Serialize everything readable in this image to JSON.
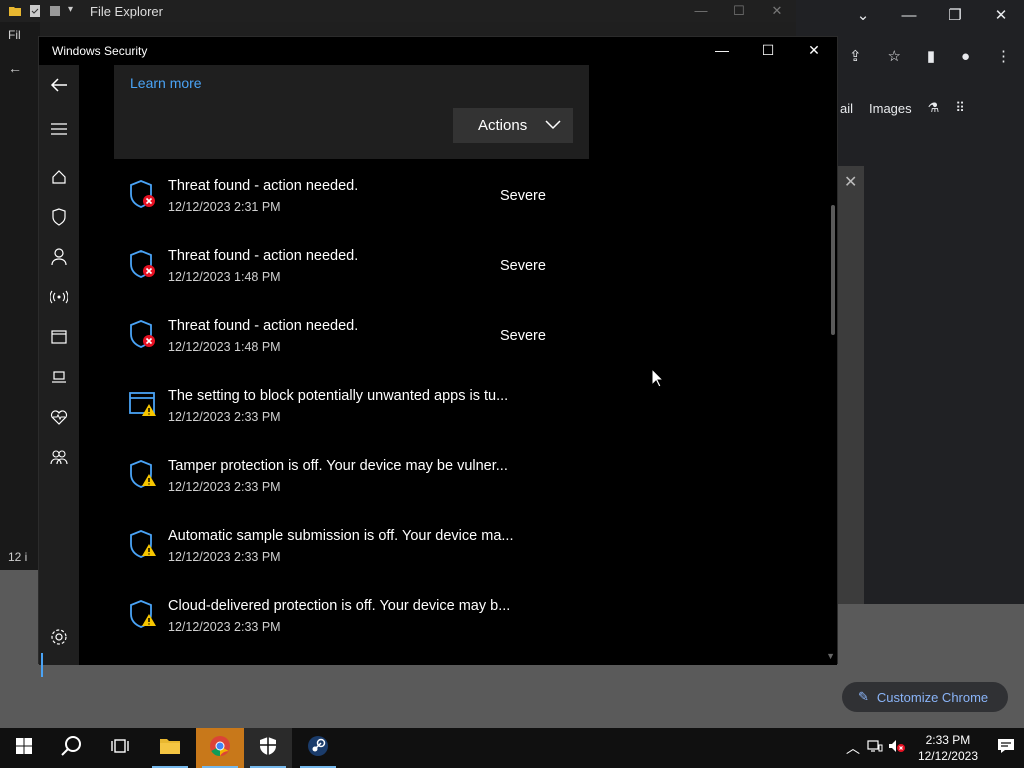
{
  "file_explorer": {
    "title": "File Explorer",
    "left_items": [
      "Fil",
      "12 i"
    ],
    "controls": [
      "—",
      "☐",
      "✕"
    ]
  },
  "chrome": {
    "links": [
      "ail",
      "Images"
    ],
    "customize_label": "Customize Chrome"
  },
  "windows_security": {
    "title": "Windows Security",
    "controls": [
      "—",
      "☐",
      "✕"
    ],
    "learn_more": "Learn more",
    "actions_label": "Actions",
    "threats": [
      {
        "title": "Threat found - action needed.",
        "time": "12/12/2023 2:31 PM",
        "severity": "Severe",
        "icon": "shield-red-x-icon"
      },
      {
        "title": "Threat found - action needed.",
        "time": "12/12/2023 1:48 PM",
        "severity": "Severe",
        "icon": "shield-red-x-icon"
      },
      {
        "title": "Threat found - action needed.",
        "time": "12/12/2023 1:48 PM",
        "severity": "Severe",
        "icon": "shield-red-x-icon"
      },
      {
        "title": "The setting to block potentially unwanted apps is tu...",
        "time": "12/12/2023 2:33 PM",
        "severity": "",
        "icon": "app-browser-warning-icon"
      },
      {
        "title": "Tamper protection is off. Your device may be vulner...",
        "time": "12/12/2023 2:33 PM",
        "severity": "",
        "icon": "shield-warning-icon"
      },
      {
        "title": "Automatic sample submission is off. Your device ma...",
        "time": "12/12/2023 2:33 PM",
        "severity": "",
        "icon": "shield-warning-icon"
      },
      {
        "title": "Cloud-delivered protection is off. Your device may b...",
        "time": "12/12/2023 2:33 PM",
        "severity": "",
        "icon": "shield-warning-icon"
      }
    ]
  },
  "taskbar": {
    "time": "2:33 PM",
    "date": "12/12/2023"
  },
  "colors": {
    "accent": "#4aa3f5",
    "severe_red": "#e81123",
    "warning_yellow": "#f7c600"
  }
}
